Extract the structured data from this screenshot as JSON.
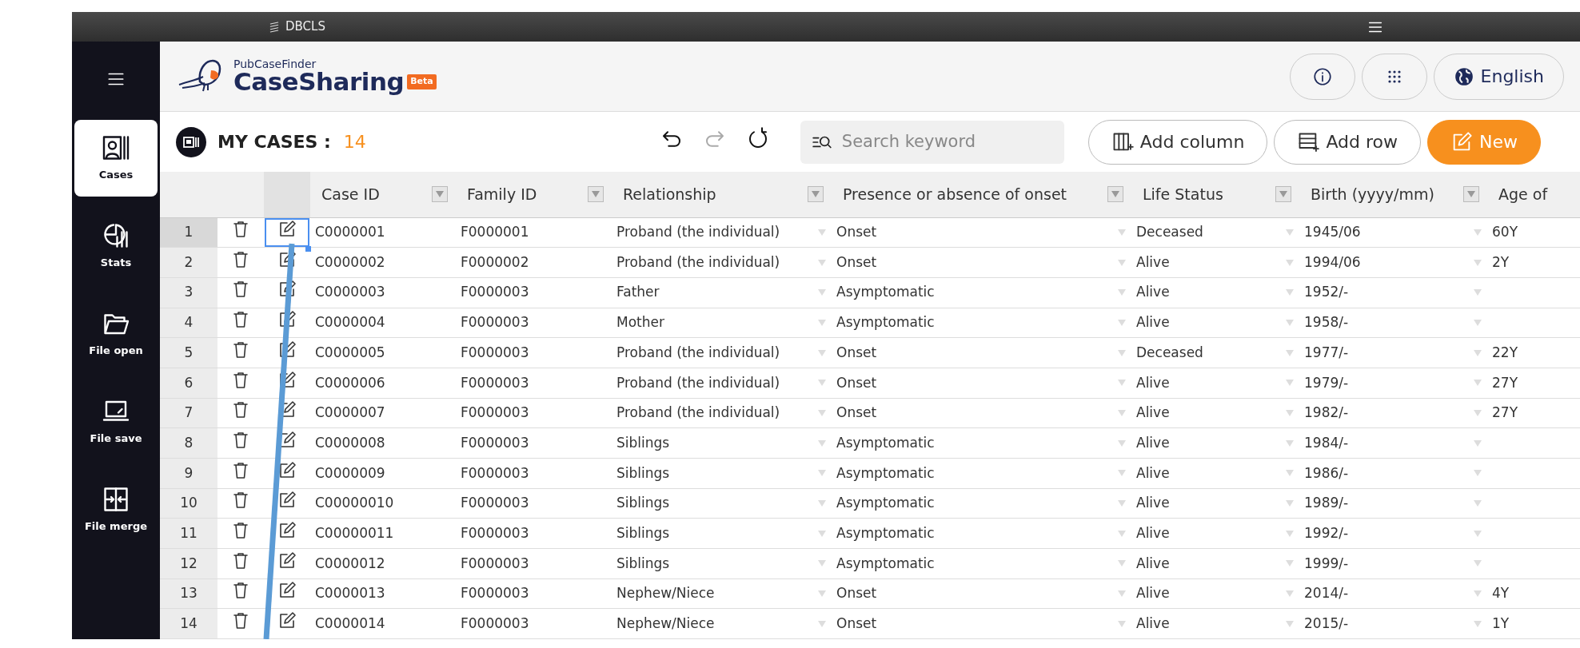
{
  "top_bar": {
    "brand": "DBCLS"
  },
  "header": {
    "subtitle": "PubCaseFinder",
    "title": "CaseSharing",
    "badge": "Beta",
    "language": "English"
  },
  "sidebar": {
    "items": [
      {
        "kind": "cases",
        "label": "Cases",
        "selected": true
      },
      {
        "kind": "stats",
        "label": "Stats",
        "selected": false
      },
      {
        "kind": "open",
        "label": "File open",
        "selected": false
      },
      {
        "kind": "save",
        "label": "File save",
        "selected": false
      },
      {
        "kind": "merge",
        "label": "File merge",
        "selected": false
      }
    ]
  },
  "toolbar": {
    "title": "MY CASES :",
    "count": "14",
    "history": [
      {
        "kind": "undo",
        "disabled": false
      },
      {
        "kind": "redo",
        "disabled": true
      },
      {
        "kind": "reset",
        "disabled": false
      }
    ],
    "search": {
      "placeholder": "Search keyword"
    },
    "buttons": [
      {
        "kind": "add-column",
        "label": "Add column"
      },
      {
        "kind": "add-row",
        "label": "Add row"
      },
      {
        "kind": "new",
        "label": "New"
      }
    ]
  },
  "table": {
    "columns": [
      {
        "label": "Case ID",
        "dropdown": false
      },
      {
        "label": "Family ID",
        "dropdown": false
      },
      {
        "label": "Relationship",
        "dropdown": true
      },
      {
        "label": "Presence or absence of onset",
        "dropdown": true
      },
      {
        "label": "Life Status",
        "dropdown": true
      },
      {
        "label": "Birth (yyyy/mm)",
        "dropdown": true
      },
      {
        "label": "Age of",
        "dropdown": false
      }
    ],
    "rows": [
      {
        "number": "1",
        "selected": true,
        "cells": [
          "C0000001",
          "F0000001",
          "Proband (the individual)",
          "Onset",
          "Deceased",
          "1945/06",
          "60Y"
        ]
      },
      {
        "number": "2",
        "selected": false,
        "cells": [
          "C0000002",
          "F0000002",
          "Proband (the individual)",
          "Onset",
          "Alive",
          "1994/06",
          "2Y"
        ]
      },
      {
        "number": "3",
        "selected": false,
        "cells": [
          "C0000003",
          "F0000003",
          "Father",
          "Asymptomatic",
          "Alive",
          "1952/-",
          ""
        ]
      },
      {
        "number": "4",
        "selected": false,
        "cells": [
          "C0000004",
          "F0000003",
          "Mother",
          "Asymptomatic",
          "Alive",
          "1958/-",
          ""
        ]
      },
      {
        "number": "5",
        "selected": false,
        "cells": [
          "C0000005",
          "F0000003",
          "Proband (the individual)",
          "Onset",
          "Deceased",
          "1977/-",
          "22Y"
        ]
      },
      {
        "number": "6",
        "selected": false,
        "cells": [
          "C0000006",
          "F0000003",
          "Proband (the individual)",
          "Onset",
          "Alive",
          "1979/-",
          "27Y"
        ]
      },
      {
        "number": "7",
        "selected": false,
        "cells": [
          "C0000007",
          "F0000003",
          "Proband (the individual)",
          "Onset",
          "Alive",
          "1982/-",
          "27Y"
        ]
      },
      {
        "number": "8",
        "selected": false,
        "cells": [
          "C0000008",
          "F0000003",
          "Siblings",
          "Asymptomatic",
          "Alive",
          "1984/-",
          ""
        ]
      },
      {
        "number": "9",
        "selected": false,
        "cells": [
          "C0000009",
          "F0000003",
          "Siblings",
          "Asymptomatic",
          "Alive",
          "1986/-",
          ""
        ]
      },
      {
        "number": "10",
        "selected": false,
        "cells": [
          "C00000010",
          "F0000003",
          "Siblings",
          "Asymptomatic",
          "Alive",
          "1989/-",
          ""
        ]
      },
      {
        "number": "11",
        "selected": false,
        "cells": [
          "C00000011",
          "F0000003",
          "Siblings",
          "Asymptomatic",
          "Alive",
          "1992/-",
          ""
        ]
      },
      {
        "number": "12",
        "selected": false,
        "cells": [
          "C0000012",
          "F0000003",
          "Siblings",
          "Asymptomatic",
          "Alive",
          "1999/-",
          ""
        ]
      },
      {
        "number": "13",
        "selected": false,
        "cells": [
          "C0000013",
          "F0000003",
          "Nephew/Niece",
          "Onset",
          "Alive",
          "2014/-",
          "4Y"
        ]
      },
      {
        "number": "14",
        "selected": false,
        "cells": [
          "C0000014",
          "F0000003",
          "Nephew/Niece",
          "Onset",
          "Alive",
          "2015/-",
          "1Y"
        ]
      }
    ]
  }
}
